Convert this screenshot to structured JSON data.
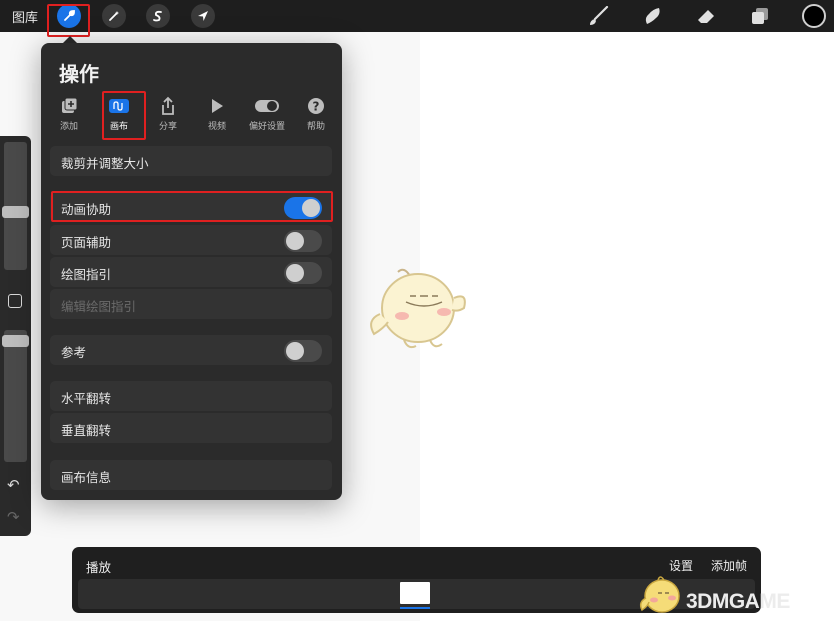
{
  "topbar": {
    "gallery_label": "图库",
    "tools": [
      {
        "name": "actions",
        "icon": "wrench-icon",
        "active": true
      },
      {
        "name": "adjustments",
        "icon": "magic-wand-icon",
        "active": false
      },
      {
        "name": "selection",
        "icon": "selection-s-icon",
        "active": false
      },
      {
        "name": "transform",
        "icon": "arrow-cursor-icon",
        "active": false
      }
    ],
    "right_tools": [
      "brush-icon",
      "smudge-icon",
      "eraser-icon",
      "layers-icon"
    ],
    "current_color": "#000000"
  },
  "actions_panel": {
    "title": "操作",
    "tabs": [
      {
        "label": "添加",
        "icon": "add-image-icon"
      },
      {
        "label": "画布",
        "icon": "canvas-icon",
        "active": true
      },
      {
        "label": "分享",
        "icon": "share-icon"
      },
      {
        "label": "视频",
        "icon": "play-icon"
      },
      {
        "label": "偏好设置",
        "icon": "toggle-icon"
      },
      {
        "label": "帮助",
        "icon": "help-icon"
      }
    ],
    "rows": {
      "crop_resize": "裁剪并调整大小",
      "animation_assist": {
        "label": "动画协助",
        "on": true
      },
      "page_assist": {
        "label": "页面辅助",
        "on": false
      },
      "drawing_guide": {
        "label": "绘图指引",
        "on": false
      },
      "edit_drawing_guide": "编辑绘图指引",
      "reference": {
        "label": "参考",
        "on": false
      },
      "flip_horizontal": "水平翻转",
      "flip_vertical": "垂直翻转",
      "canvas_info": "画布信息"
    }
  },
  "animation_panel": {
    "play_label": "播放",
    "settings_label": "设置",
    "add_frame_label": "添加帧"
  },
  "watermark": "3DMGAME",
  "colors": {
    "accent": "#1a74e8",
    "highlight": "#e02020",
    "panel_bg": "#2b2b2b"
  }
}
